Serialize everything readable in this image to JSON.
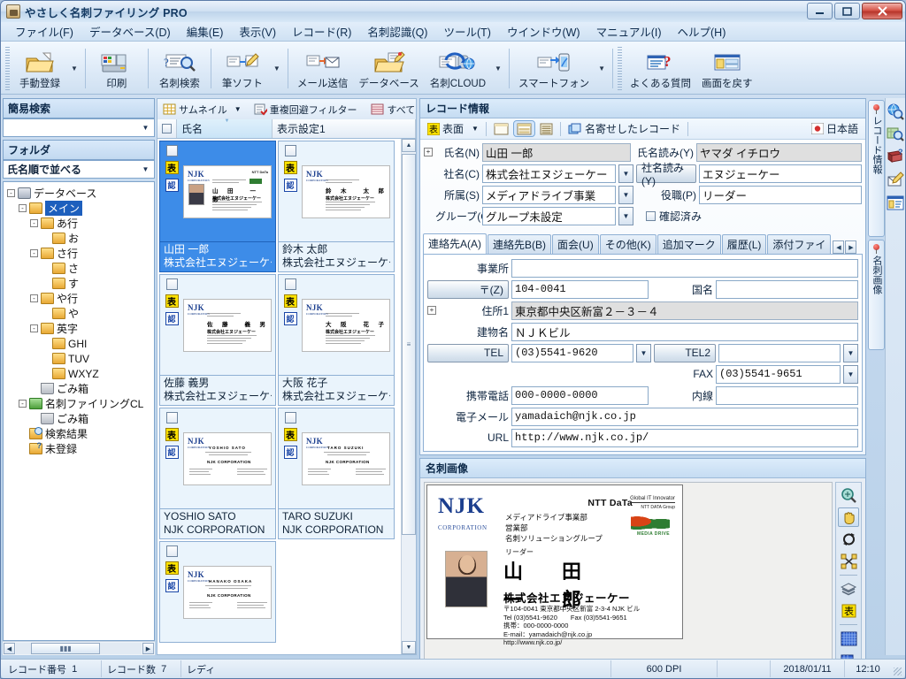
{
  "window": {
    "title": "やさしく名刺ファイリング PRO",
    "minimize": "—",
    "maximize": "❐",
    "close": "✕"
  },
  "menubar": [
    {
      "label": "ファイル(F)"
    },
    {
      "label": "データベース(D)"
    },
    {
      "label": "編集(E)"
    },
    {
      "label": "表示(V)"
    },
    {
      "label": "レコード(R)"
    },
    {
      "label": "名刺認識(Q)"
    },
    {
      "label": "ツール(T)"
    },
    {
      "label": "ウインドウ(W)"
    },
    {
      "label": "マニュアル(I)"
    },
    {
      "label": "ヘルプ(H)"
    }
  ],
  "toolbar": [
    {
      "label": "手動登録",
      "icon": "open-folder-icon",
      "dropdown": true
    },
    {
      "label": "印刷",
      "icon": "printer-icon",
      "dropdown": false
    },
    {
      "label": "名刺検索",
      "icon": "card-search-icon",
      "dropdown": false
    },
    {
      "label": "筆ソフト",
      "icon": "pen-software-icon",
      "dropdown": true
    },
    {
      "label": "メール送信",
      "icon": "mail-send-icon",
      "dropdown": false
    },
    {
      "label": "データベース",
      "icon": "database-icon",
      "dropdown": false
    },
    {
      "label": "名刺CLOUD",
      "icon": "card-cloud-icon",
      "dropdown": true
    },
    {
      "label": "スマートフォン",
      "icon": "smartphone-icon",
      "dropdown": true
    },
    {
      "label": "よくある質問",
      "icon": "faq-icon",
      "dropdown": false
    },
    {
      "label": "画面を戻す",
      "icon": "restore-screen-icon",
      "dropdown": false
    }
  ],
  "sidebar": {
    "quick_search_caption": "簡易検索",
    "quick_search_value": "",
    "folder_caption": "フォルダ",
    "sort_value": "氏名順で並べる",
    "tree": [
      {
        "label": "データベース",
        "depth": 0,
        "icon": "database-icon",
        "expander": "-",
        "selected": false
      },
      {
        "label": "メイン",
        "depth": 1,
        "icon": "folder-icon",
        "expander": "-",
        "selected": true
      },
      {
        "label": "あ行",
        "depth": 2,
        "icon": "folder-icon",
        "expander": "-",
        "selected": false
      },
      {
        "label": "お",
        "depth": 3,
        "icon": "folder-icon",
        "expander": "",
        "selected": false
      },
      {
        "label": "さ行",
        "depth": 2,
        "icon": "folder-icon",
        "expander": "-",
        "selected": false
      },
      {
        "label": "さ",
        "depth": 3,
        "icon": "folder-icon",
        "expander": "",
        "selected": false
      },
      {
        "label": "す",
        "depth": 3,
        "icon": "folder-icon",
        "expander": "",
        "selected": false
      },
      {
        "label": "や行",
        "depth": 2,
        "icon": "folder-icon",
        "expander": "-",
        "selected": false
      },
      {
        "label": "や",
        "depth": 3,
        "icon": "folder-icon",
        "expander": "",
        "selected": false
      },
      {
        "label": "英字",
        "depth": 2,
        "icon": "folder-icon",
        "expander": "-",
        "selected": false
      },
      {
        "label": "GHI",
        "depth": 3,
        "icon": "folder-icon",
        "expander": "",
        "selected": false
      },
      {
        "label": "TUV",
        "depth": 3,
        "icon": "folder-icon",
        "expander": "",
        "selected": false
      },
      {
        "label": "WXYZ",
        "depth": 3,
        "icon": "folder-icon",
        "expander": "",
        "selected": false
      },
      {
        "label": "ごみ箱",
        "depth": 2,
        "icon": "trash-icon",
        "expander": "",
        "selected": false
      },
      {
        "label": "名刺ファイリングCL",
        "depth": 1,
        "icon": "cloud-icon",
        "expander": "-",
        "selected": false
      },
      {
        "label": "ごみ箱",
        "depth": 2,
        "icon": "trash-icon",
        "expander": "",
        "selected": false
      },
      {
        "label": "検索結果",
        "depth": 1,
        "icon": "search-folder-icon",
        "expander": "",
        "selected": false
      },
      {
        "label": "未登録",
        "depth": 1,
        "icon": "unregistered-folder-icon",
        "expander": "",
        "selected": false
      }
    ]
  },
  "list": {
    "view_mode": "サムネイル",
    "dup_filter": "重複回避フィルター",
    "all_filter": "すべて",
    "columns": [
      "氏名",
      "表示設定1"
    ],
    "cards": [
      {
        "name": "山田 一郎",
        "company": "株式会社エヌジェーケー",
        "selected": true,
        "card": {
          "style": "jp-photo",
          "dept1": "メディアドライブ事業部",
          "dept2": "営業部",
          "dept3": "名刺ソリューショングループ",
          "role": "リーダー",
          "display_name": "山　田　　一　郎"
        }
      },
      {
        "name": "鈴木 太郎",
        "company": "株式会社エヌジェーケー",
        "selected": false,
        "card": {
          "style": "jp-plain",
          "dept1": "ソリューション営業部",
          "dept2": "営業",
          "display_name": "鈴　木　　太　郎"
        }
      },
      {
        "name": "佐藤 義男",
        "company": "株式会社エヌジェーケー",
        "selected": false,
        "card": {
          "style": "jp-plain",
          "dept1": "ソリューション営業第1部",
          "dept2": "課長",
          "display_name": "佐　藤　　義　男"
        }
      },
      {
        "name": "大阪 花子",
        "company": "株式会社エヌジェーケー",
        "selected": false,
        "card": {
          "style": "jp-plain",
          "dept1": "セクションマネージャ",
          "dept2": "コンサルティングチーム",
          "display_name": "大　阪　　花　子"
        }
      },
      {
        "name": "YOSHIO SATO",
        "company": "NJK CORPORATION",
        "selected": false,
        "card": {
          "style": "en",
          "dept1": "Manager",
          "dept2": "Planning Division",
          "dept3": "Sales Department",
          "display_name": "YOSHIO  SATO",
          "org": "NJK CORPORATION"
        }
      },
      {
        "name": "TARO SUZUKI",
        "company": "NJK CORPORATION",
        "selected": false,
        "card": {
          "style": "en",
          "dept1": "General Manager",
          "dept2": "Solution Sales Department",
          "display_name": "TARO  SUZUKI",
          "org": "NJK CORPORATION"
        }
      },
      {
        "name": "",
        "company": "",
        "selected": false,
        "card": {
          "style": "en",
          "dept1": "Consulting Team",
          "dept2": "Cloud Business Department",
          "display_name": "HANAKO  OSAKA",
          "org": "NJK CORPORATION"
        }
      }
    ],
    "mark_front": "表",
    "mark_recognized": "認"
  },
  "record_panel": {
    "caption": "レコード情報",
    "side_label": "表面",
    "merged_records": "名寄せしたレコード",
    "language": "日本語",
    "fields": {
      "name_label": "氏名(N)",
      "name_value": "山田 一郎",
      "name_kana_label": "氏名読み(Y)",
      "name_kana_value": "ヤマダ イチロウ",
      "company_label": "社名(C)",
      "company_value": "株式会社エヌジェーケー",
      "company_kana_label": "社名読み(Y)",
      "company_kana_value": "エヌジェーケー",
      "dept_label": "所属(S)",
      "dept_value": "メディアドライブ事業",
      "title_label": "役職(P)",
      "title_value": "リーダー",
      "group_label": "グループ(G)",
      "group_value": "グループ未設定",
      "confirmed_label": "確認済み",
      "confirmed_checked": false
    },
    "tabs": [
      {
        "label": "連絡先A(A)",
        "active": true
      },
      {
        "label": "連絡先B(B)",
        "active": false
      },
      {
        "label": "面会(U)",
        "active": false
      },
      {
        "label": "その他(K)",
        "active": false
      },
      {
        "label": "追加マーク",
        "active": false
      },
      {
        "label": "履歴(L)",
        "active": false
      },
      {
        "label": "添付ファイ",
        "active": false
      }
    ],
    "contact": {
      "office_label": "事業所",
      "office_value": "",
      "zip_label": "〒(Z)",
      "zip_value": "104-0041",
      "country_label": "国名",
      "country_value": "",
      "address1_label": "住所1",
      "address1_value": "東京都中央区新富２－３－４",
      "building_label": "建物名",
      "building_value": "ＮＪＫビル",
      "tel_label": "TEL",
      "tel_value": "(03)5541-9620",
      "tel2_label": "TEL2",
      "tel2_value": "",
      "fax_label": "FAX",
      "fax_value": "(03)5541-9651",
      "mobile_label": "携帯電話",
      "mobile_value": "000-0000-0000",
      "ext_label": "内線",
      "ext_value": "",
      "email_label": "電子メール",
      "email_value": "yamadaich@njk.co.jp",
      "url_label": "URL",
      "url_value": "http://www.njk.co.jp/"
    }
  },
  "card_image_panel": {
    "caption": "名刺画像",
    "tools": [
      {
        "name": "zoom-icon",
        "selected": false
      },
      {
        "name": "hand-pan-icon",
        "selected": true
      },
      {
        "name": "rotate-icon",
        "selected": false
      },
      {
        "name": "fit-screen-icon",
        "selected": false
      },
      {
        "name": "layers-icon",
        "selected": false
      },
      {
        "name": "front-side-icon",
        "selected": false
      },
      {
        "name": "image-grid-icon",
        "selected": false
      },
      {
        "name": "export-image-icon",
        "selected": false
      }
    ],
    "card": {
      "logo": "NJK",
      "logo_sub": "CORPORATION",
      "partner": "NTT DaTa",
      "partner_tag": "Global IT Innovator",
      "partner_sub": "NTT DATA Group",
      "md_logo_text": "MEDIA DRIVE",
      "dept1": "メディアドライブ事業部",
      "dept2": "営業部",
      "dept3": "名刺ソリューショングループ",
      "role": "リーダー",
      "name": "山　田　　　一　郎",
      "company": "株式会社エヌジェーケー",
      "address": "〒104-0041 東京都中央区新富 2-3-4 NJK ビル",
      "tel": "Tel (03)5541-9620　　Fax (03)5541-9651",
      "mobile": "携帯：000-0000-0000",
      "email": "E-mail：yamadaich@njk.co.jp",
      "url": "http://www.njk.co.jp/"
    }
  },
  "rail": {
    "tabs": [
      {
        "label": "レコード情報"
      },
      {
        "label": "名刺画像"
      }
    ],
    "icons": [
      {
        "name": "globe-search-icon"
      },
      {
        "name": "map-search-icon"
      },
      {
        "name": "address-book-icon"
      },
      {
        "name": "mail-compose-icon"
      },
      {
        "name": "record-card-icon"
      }
    ]
  },
  "statusbar": {
    "record_no_label": "レコード番号",
    "record_no_value": "1",
    "record_count_label": "レコード数",
    "record_count_value": "7",
    "ready": "レディ",
    "dpi": "600 DPI",
    "date": "2018/01/11",
    "time": "12:10"
  }
}
